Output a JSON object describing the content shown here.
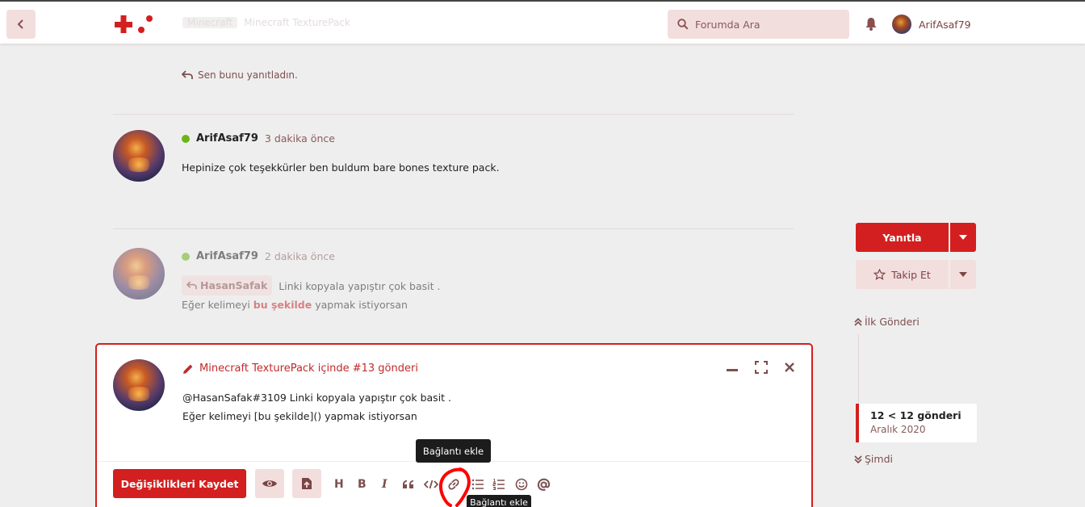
{
  "header": {
    "faded_pill": "Minecraft",
    "faded_title": "Minecraft TexturePack",
    "search_placeholder": "Forumda Ara",
    "user": "ArifAsaf79"
  },
  "feed": {
    "replied_note": "Sen bunu yanıtladın.",
    "post1": {
      "user": "ArifAsaf79",
      "time": "3 dakika önce",
      "body": "Hepinize çok teşekkürler ben buldum bare bones texture pack."
    },
    "post2": {
      "user": "ArifAsaf79",
      "time": "2 dakika önce",
      "mention": "HasanSafak",
      "line1": "Linki kopyala yapıştır çok basit .",
      "line2_a": "Eğer kelimeyi",
      "line2_link": "bu şekilde",
      "line2_b": "yapmak istiyorsan"
    }
  },
  "sidebar": {
    "reply": "Yanıtla",
    "follow": "Takip Et",
    "first_post": "İlk Gönderi",
    "count": "12 < 12 gönderi",
    "date": "Aralık 2020",
    "now": "Şimdi"
  },
  "composer": {
    "title": "Minecraft TexturePack içinde #13 gönderi",
    "line1": "@HasanSafak#3109 Linki kopyala yapıştır çok basit .",
    "line2": "Eğer kelimeyi [bu şekilde]() yapmak istiyorsan",
    "save": "Değişiklikleri Kaydet",
    "tooltip": "Bağlantı ekle",
    "tooltip_dup": "Bağlantı ekle",
    "tb": {
      "h": "H",
      "b": "B",
      "i": "I"
    }
  },
  "colors": {
    "accent": "#d31f1f",
    "soft": "#f3dede",
    "online": "#6ab51a"
  }
}
